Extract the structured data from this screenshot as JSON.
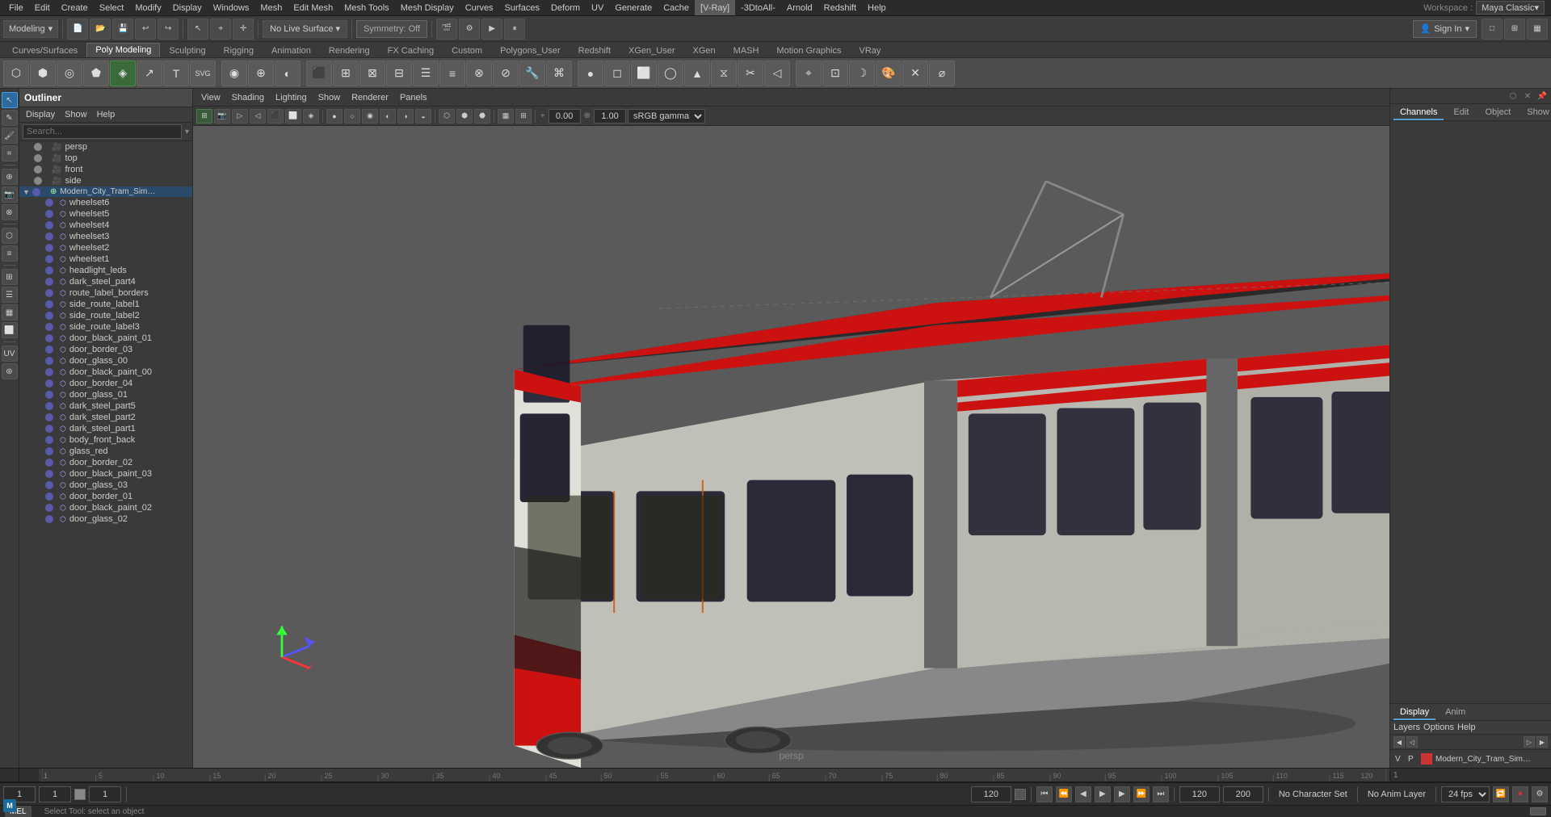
{
  "menubar": {
    "items": [
      "File",
      "Edit",
      "Create",
      "Select",
      "Modify",
      "Display",
      "Windows",
      "Mesh",
      "Edit Mesh",
      "Mesh Tools",
      "Mesh Display",
      "Curves",
      "Surfaces",
      "Deform",
      "UV",
      "Generate",
      "Cache",
      "[V-Ray]",
      "-3DtoAll-",
      "Arnold",
      "Redshift",
      "Help"
    ],
    "workspace_label": "Workspace :",
    "workspace_value": "Maya Classic▾"
  },
  "toolbar1": {
    "mode_label": "Modeling",
    "live_surface": "No Live Surface",
    "symmetry": "Symmetry: Off",
    "sign_in": "Sign In"
  },
  "shelf_tabs": {
    "tabs": [
      "Curves/Surfaces",
      "Poly Modeling",
      "Sculpting",
      "Rigging",
      "Animation",
      "Rendering",
      "FX Caching",
      "Custom",
      "Polygons_User",
      "Redshift",
      "XGen_User",
      "XGen",
      "MASH",
      "Motion Graphics",
      "VRay"
    ]
  },
  "outliner": {
    "title": "Outliner",
    "menus": [
      "Display",
      "Show",
      "Help"
    ],
    "search_placeholder": "Search...",
    "items": [
      {
        "name": "persp",
        "type": "camera",
        "indent": 1,
        "has_arrow": false
      },
      {
        "name": "top",
        "type": "camera",
        "indent": 1,
        "has_arrow": false
      },
      {
        "name": "front",
        "type": "camera",
        "indent": 1,
        "has_arrow": false
      },
      {
        "name": "side",
        "type": "camera",
        "indent": 1,
        "has_arrow": false
      },
      {
        "name": "Modern_City_Tram_Simple_Interior_n...",
        "type": "group",
        "indent": 0,
        "has_arrow": true
      },
      {
        "name": "wheelset6",
        "type": "mesh",
        "indent": 2
      },
      {
        "name": "wheelset5",
        "type": "mesh",
        "indent": 2
      },
      {
        "name": "wheelset4",
        "type": "mesh",
        "indent": 2
      },
      {
        "name": "wheelset3",
        "type": "mesh",
        "indent": 2
      },
      {
        "name": "wheelset2",
        "type": "mesh",
        "indent": 2
      },
      {
        "name": "wheelset1",
        "type": "mesh",
        "indent": 2
      },
      {
        "name": "headlight_leds",
        "type": "mesh",
        "indent": 2
      },
      {
        "name": "dark_steel_part4",
        "type": "mesh",
        "indent": 2
      },
      {
        "name": "route_label_borders",
        "type": "mesh",
        "indent": 2
      },
      {
        "name": "side_route_label1",
        "type": "mesh",
        "indent": 2
      },
      {
        "name": "side_route_label2",
        "type": "mesh",
        "indent": 2
      },
      {
        "name": "side_route_label3",
        "type": "mesh",
        "indent": 2
      },
      {
        "name": "door_black_paint_01",
        "type": "mesh",
        "indent": 2
      },
      {
        "name": "door_border_03",
        "type": "mesh",
        "indent": 2
      },
      {
        "name": "door_glass_00",
        "type": "mesh",
        "indent": 2
      },
      {
        "name": "door_black_paint_00",
        "type": "mesh",
        "indent": 2
      },
      {
        "name": "door_border_04",
        "type": "mesh",
        "indent": 2
      },
      {
        "name": "door_glass_01",
        "type": "mesh",
        "indent": 2
      },
      {
        "name": "dark_steel_part5",
        "type": "mesh",
        "indent": 2
      },
      {
        "name": "dark_steel_part2",
        "type": "mesh",
        "indent": 2
      },
      {
        "name": "dark_steel_part1",
        "type": "mesh",
        "indent": 2
      },
      {
        "name": "body_front_back",
        "type": "mesh",
        "indent": 2
      },
      {
        "name": "glass_red",
        "type": "mesh",
        "indent": 2
      },
      {
        "name": "door_border_02",
        "type": "mesh",
        "indent": 2
      },
      {
        "name": "door_black_paint_03",
        "type": "mesh",
        "indent": 2
      },
      {
        "name": "door_glass_03",
        "type": "mesh",
        "indent": 2
      },
      {
        "name": "door_border_01",
        "type": "mesh",
        "indent": 2
      },
      {
        "name": "door_black_paint_02",
        "type": "mesh",
        "indent": 2
      },
      {
        "name": "door_glass_02",
        "type": "mesh",
        "indent": 2
      }
    ]
  },
  "viewport": {
    "menus": [
      "View",
      "Shading",
      "Lighting",
      "Show",
      "Renderer",
      "Panels"
    ],
    "value1": "0.00",
    "value2": "1.00",
    "gamma": "sRGB gamma",
    "label": "persp"
  },
  "right_panel": {
    "tabs": [
      "Channels",
      "Edit",
      "Object",
      "Show"
    ],
    "display_tabs": [
      "Display",
      "Anim"
    ],
    "layer_menus": [
      "Layers",
      "Options",
      "Help"
    ],
    "layer_item": "Modern_City_Tram_Simple_Inte..."
  },
  "timeline": {
    "ticks": [
      1,
      5,
      10,
      15,
      20,
      25,
      30,
      35,
      40,
      45,
      50,
      55,
      60,
      65,
      70,
      75,
      80,
      85,
      90,
      95,
      100,
      105,
      110,
      115,
      120
    ]
  },
  "status_bar": {
    "frame1": "1",
    "frame2": "1",
    "frame3": "1",
    "range_start": "120",
    "range_end": "120",
    "max_val": "200",
    "no_character_set": "No Character Set",
    "no_anim_layer": "No Anim Layer",
    "fps": "24 fps"
  },
  "bottom_bar": {
    "tab": "MEL",
    "status": "Select Tool: select an object"
  },
  "colors": {
    "accent_blue": "#5a9fd4",
    "tram_red": "#cc1111",
    "active_tool": "#2d6a9f"
  }
}
